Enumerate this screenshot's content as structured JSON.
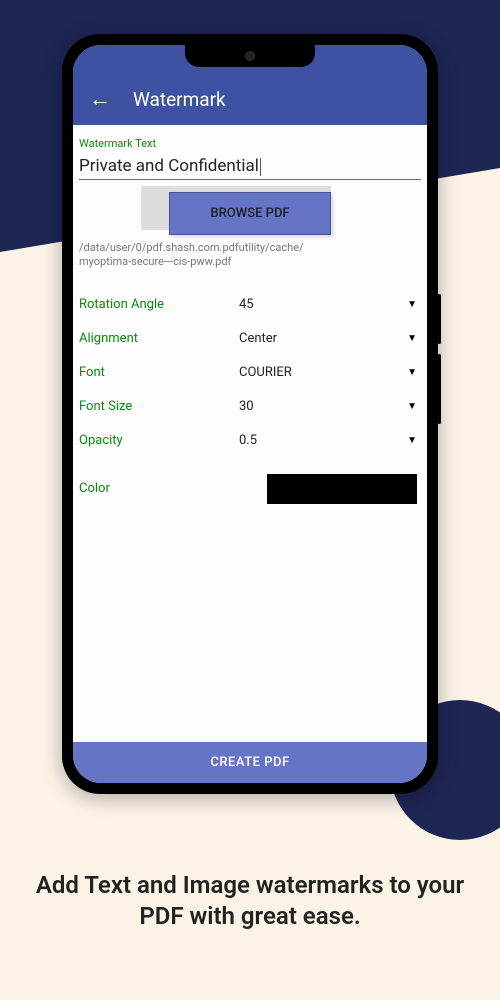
{
  "appbar": {
    "title": "Watermark"
  },
  "watermark": {
    "text_label": "Watermark Text",
    "text_value": "Private and Confidential"
  },
  "browse": {
    "label": "BROWSE PDF"
  },
  "filepath": "/data/user/0/pdf.shash.com.pdfutility/cache/\nmyoptima-secure---cis-pww.pdf",
  "rows": {
    "rotation": {
      "label": "Rotation Angle",
      "value": "45"
    },
    "alignment": {
      "label": "Alignment",
      "value": "Center"
    },
    "font": {
      "label": "Font",
      "value": "COURIER"
    },
    "fontsize": {
      "label": "Font Size",
      "value": "30"
    },
    "opacity": {
      "label": "Opacity",
      "value": "0.5"
    },
    "color": {
      "label": "Color",
      "hex": "#000000"
    }
  },
  "create": {
    "label": "CREATE PDF"
  },
  "caption": "Add Text and Image watermarks to your PDF with great ease."
}
